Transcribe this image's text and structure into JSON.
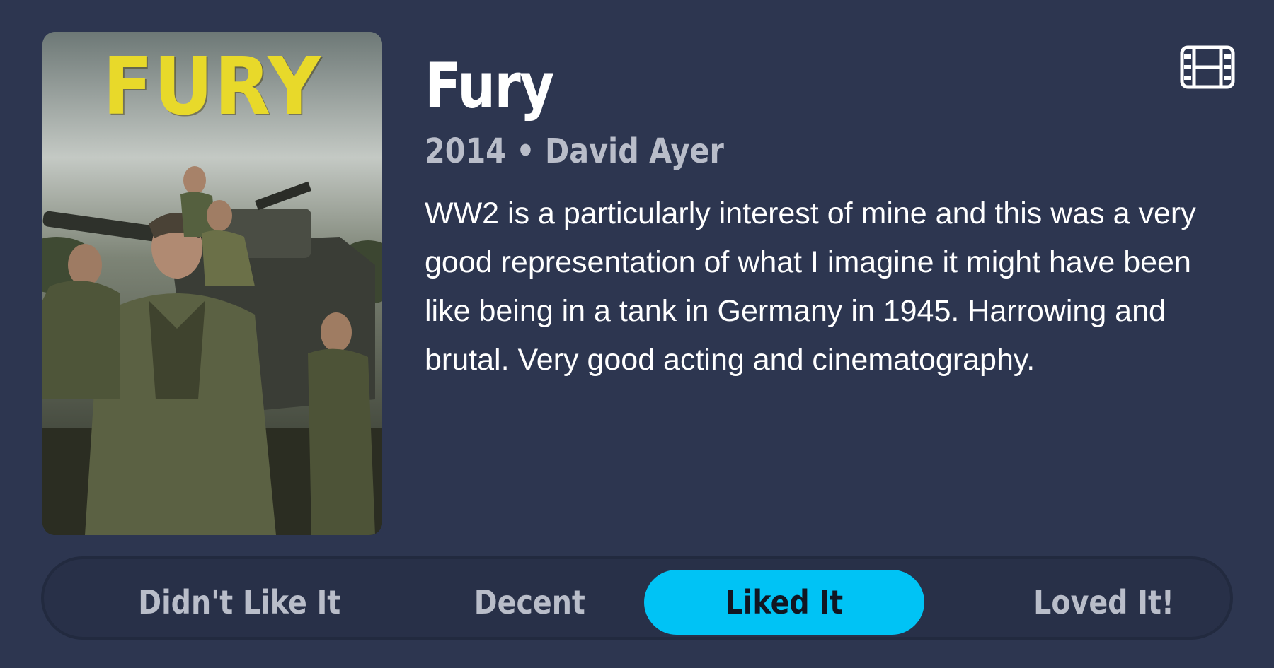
{
  "movie": {
    "poster_title": "FURY",
    "title": "Fury",
    "meta": "2014 • David Ayer",
    "review": "WW2 is a particularly interest of mine and this was a very good representation of what I imagine it might have been like being in a tank in Germany in 1945. Harrowing and brutal. Very good acting and cinematography."
  },
  "icons": {
    "film": "film-icon"
  },
  "rating": {
    "options": [
      {
        "label": "Didn't Like It"
      },
      {
        "label": "Decent"
      },
      {
        "label": "Liked It"
      },
      {
        "label": "Loved It!"
      }
    ],
    "selected": "Liked It"
  },
  "colors": {
    "background": "#2d3650",
    "accent": "#00c3f5",
    "poster_title": "#e8d92a",
    "muted_text": "#b9bdc9"
  }
}
